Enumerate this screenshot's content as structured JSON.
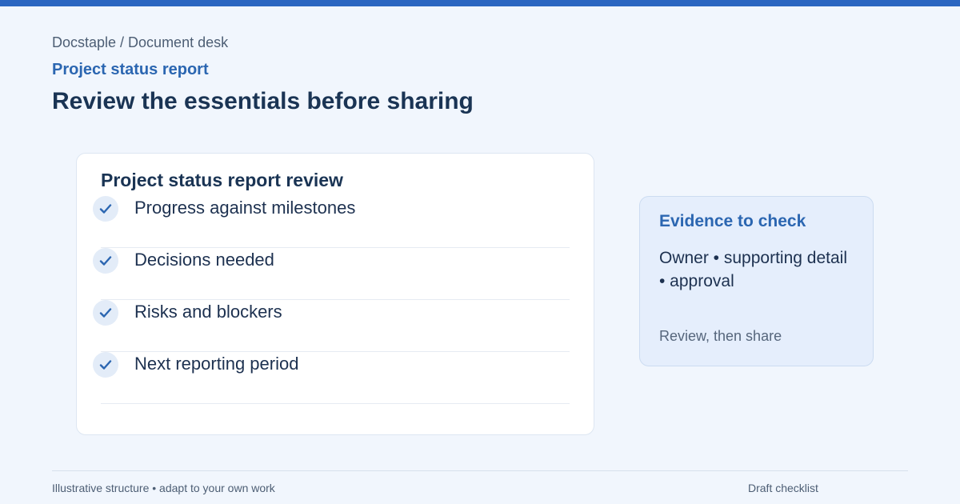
{
  "header": {
    "breadcrumb": "Docstaple / Document desk",
    "eyebrow": "Project status report",
    "title": "Review the essentials before sharing"
  },
  "checklist": {
    "title": "Project status report review",
    "items": [
      {
        "label": "Progress against milestones",
        "checked": true
      },
      {
        "label": "Decisions needed",
        "checked": true
      },
      {
        "label": "Risks and blockers",
        "checked": true
      },
      {
        "label": "Next reporting period",
        "checked": true
      }
    ]
  },
  "evidence": {
    "title": "Evidence to check",
    "body": "Owner • supporting detail • approval",
    "footer": "Review, then share"
  },
  "footer": {
    "left": "Illustrative structure • adapt to your own work",
    "right": "Draft checklist"
  },
  "colors": {
    "accent": "#2b66c1",
    "background": "#f1f6fd",
    "heading": "#1a3454"
  },
  "icons": {
    "check": "check-icon"
  }
}
